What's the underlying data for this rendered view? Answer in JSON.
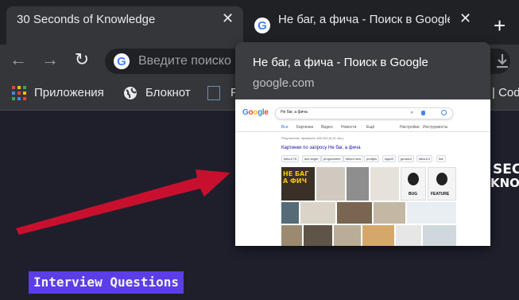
{
  "tabs": [
    {
      "title": "30 Seconds of Knowledge",
      "close": "✕"
    },
    {
      "title": "Не баг, а фича - Поиск в Google",
      "close": "✕"
    }
  ],
  "new_tab": "+",
  "omnibox": {
    "placeholder": "Введите поиско"
  },
  "bookmarks": {
    "apps": "Приложения",
    "notepad": "Блокнот",
    "partial_left": "P",
    "partial_right": "| Cod"
  },
  "hover_card": {
    "title": "Не баг, а фича - Поиск в Google",
    "url": "google.com",
    "preview": {
      "logo": "Google",
      "query": "Не баг, а фича",
      "tabs": [
        "Все",
        "Картинки",
        "Видео",
        "Новости",
        "Ещё",
        "Настройки",
        "Инструменты"
      ],
      "results_count": "Результатов: примерно 465 000 (0,31 сек.)",
      "images_heading": "Картинки по запросу Не баг, а фича",
      "chips": [
        "fallout 76",
        "ace seger",
        "programmer",
        "fallout new",
        "prodjek",
        "одкоб",
        "geoskol",
        "fallout 4",
        "баг"
      ],
      "meme_text": "НЕ БАГ\nА ФИЧ",
      "bug_label": "BUG",
      "feature_label": "FEATURE"
    }
  },
  "page": {
    "label": "Interview Questions",
    "logo_partial": [
      "SECO",
      "KNOW"
    ]
  }
}
